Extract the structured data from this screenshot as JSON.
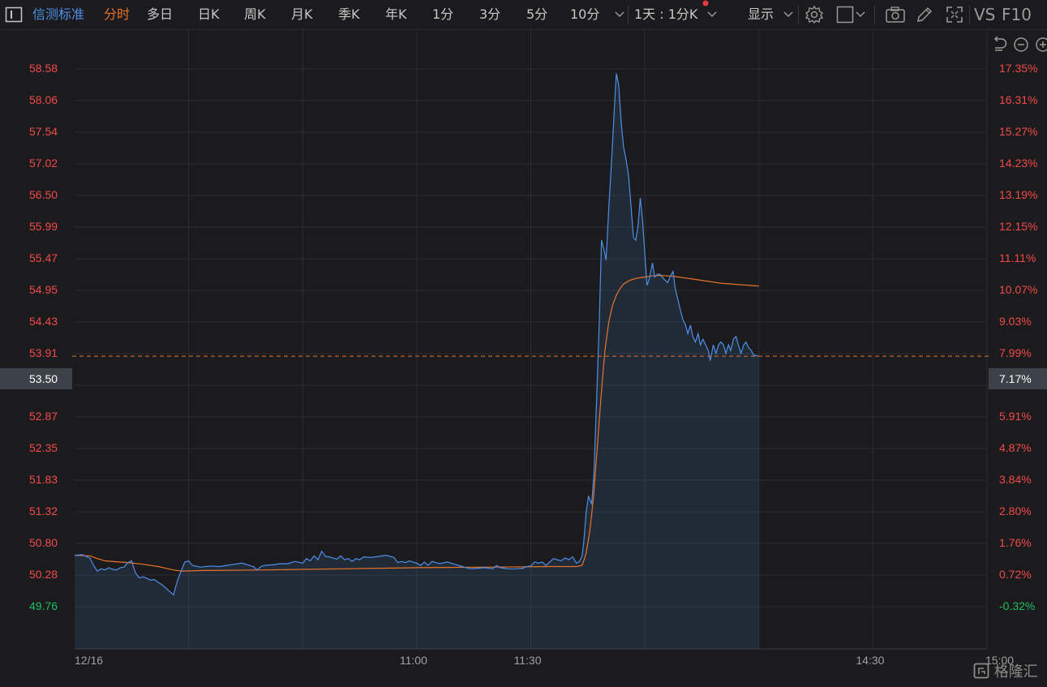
{
  "toolbar": {
    "stock_name": "信测标准",
    "active_tab": "分时",
    "tabs": [
      "多日",
      "日K",
      "周K",
      "月K",
      "季K",
      "年K",
      "1分",
      "3分",
      "5分",
      "10分"
    ],
    "period_select": "1天 : 1分K",
    "display_label": "显示",
    "vs_label": "VS",
    "f10_label": "F10"
  },
  "colors": {
    "price_line": "#4e8fe8",
    "avg_line": "#e8732a",
    "up": "#f24a4a",
    "down": "#1dbf60",
    "ref_line": "#e8732a"
  },
  "current": {
    "price": "53.50",
    "pct": "7.17%"
  },
  "watermark": "格隆汇",
  "chart_data": {
    "type": "line",
    "prev_close": 49.92,
    "ylim": [
      49.07,
      58.58
    ],
    "y_ticks_price": [
      "58.58",
      "58.06",
      "57.54",
      "57.02",
      "56.50",
      "55.99",
      "55.47",
      "54.95",
      "54.43",
      "53.91",
      "53.39",
      "52.87",
      "52.35",
      "51.83",
      "51.32",
      "50.80",
      "50.28",
      "49.76"
    ],
    "y_ticks_pct": [
      "17.35%",
      "16.31%",
      "15.27%",
      "14.23%",
      "13.19%",
      "12.15%",
      "11.11%",
      "10.07%",
      "9.03%",
      "7.99%",
      "6.95%",
      "5.91%",
      "4.87%",
      "3.84%",
      "2.80%",
      "1.76%",
      "0.72%",
      "-0.32%"
    ],
    "x_tick_labels": [
      {
        "minute": 0,
        "label": "12/16"
      },
      {
        "minute": 90,
        "label": "11:00"
      },
      {
        "minute": 120,
        "label": "11:30"
      },
      {
        "minute": 210,
        "label": "14:30"
      },
      {
        "minute": 240,
        "label": "15:00"
      }
    ],
    "session_minutes": 240,
    "x_grid_minutes": [
      30,
      60,
      90,
      120,
      150,
      180,
      210,
      240
    ],
    "series": [
      {
        "key": "price",
        "points": [
          [
            0,
            49.98
          ],
          [
            2,
            49.99
          ],
          [
            4,
            49.93
          ],
          [
            5,
            49.8
          ],
          [
            6,
            49.7
          ],
          [
            7,
            49.74
          ],
          [
            8,
            49.72
          ],
          [
            9,
            49.76
          ],
          [
            10,
            49.73
          ],
          [
            11,
            49.72
          ],
          [
            12,
            49.76
          ],
          [
            13,
            49.77
          ],
          [
            14,
            49.85
          ],
          [
            15,
            49.88
          ],
          [
            16,
            49.67
          ],
          [
            17,
            49.58
          ],
          [
            18,
            49.6
          ],
          [
            19,
            49.57
          ],
          [
            20,
            49.54
          ],
          [
            21,
            49.55
          ],
          [
            22,
            49.5
          ],
          [
            23,
            49.46
          ],
          [
            24,
            49.4
          ],
          [
            25,
            49.34
          ],
          [
            26,
            49.28
          ],
          [
            27,
            49.52
          ],
          [
            28,
            49.7
          ],
          [
            29,
            49.86
          ],
          [
            30,
            49.88
          ],
          [
            31,
            49.8
          ],
          [
            33,
            49.77
          ],
          [
            36,
            49.79
          ],
          [
            38,
            49.78
          ],
          [
            40,
            49.8
          ],
          [
            42,
            49.82
          ],
          [
            44,
            49.84
          ],
          [
            46,
            49.8
          ],
          [
            47,
            49.78
          ],
          [
            48,
            49.72
          ],
          [
            49,
            49.78
          ],
          [
            50,
            49.8
          ],
          [
            52,
            49.81
          ],
          [
            54,
            49.83
          ],
          [
            56,
            49.83
          ],
          [
            58,
            49.87
          ],
          [
            60,
            49.84
          ],
          [
            61,
            49.92
          ],
          [
            62,
            49.88
          ],
          [
            63,
            49.97
          ],
          [
            64,
            49.9
          ],
          [
            65,
            50.05
          ],
          [
            66,
            49.96
          ],
          [
            67,
            49.95
          ],
          [
            69,
            49.91
          ],
          [
            70,
            49.97
          ],
          [
            71,
            49.9
          ],
          [
            72,
            49.92
          ],
          [
            73,
            49.87
          ],
          [
            74,
            49.92
          ],
          [
            75,
            49.9
          ],
          [
            76,
            49.95
          ],
          [
            78,
            49.94
          ],
          [
            80,
            49.96
          ],
          [
            82,
            49.98
          ],
          [
            84,
            49.94
          ],
          [
            85,
            49.85
          ],
          [
            86,
            49.87
          ],
          [
            87,
            49.85
          ],
          [
            88,
            49.88
          ],
          [
            89,
            49.86
          ],
          [
            90,
            49.84
          ],
          [
            91,
            49.8
          ],
          [
            92,
            49.86
          ],
          [
            93,
            49.8
          ],
          [
            94,
            49.87
          ],
          [
            95,
            49.85
          ],
          [
            96,
            49.83
          ],
          [
            98,
            49.86
          ],
          [
            100,
            49.82
          ],
          [
            102,
            49.78
          ],
          [
            103,
            49.76
          ],
          [
            104,
            49.74
          ],
          [
            106,
            49.75
          ],
          [
            108,
            49.76
          ],
          [
            110,
            49.74
          ],
          [
            111,
            49.8
          ],
          [
            112,
            49.76
          ],
          [
            114,
            49.74
          ],
          [
            116,
            49.74
          ],
          [
            118,
            49.75
          ],
          [
            119,
            49.78
          ],
          [
            120,
            49.79
          ],
          [
            121,
            49.86
          ],
          [
            122,
            49.84
          ],
          [
            123,
            49.86
          ],
          [
            124,
            49.8
          ],
          [
            125,
            49.86
          ],
          [
            126,
            49.92
          ],
          [
            127,
            49.9
          ],
          [
            128,
            49.88
          ],
          [
            129,
            49.93
          ],
          [
            130,
            49.9
          ],
          [
            131,
            49.95
          ],
          [
            132,
            49.84
          ],
          [
            132.8,
            49.87
          ],
          [
            133.5,
            49.97
          ],
          [
            134,
            50.26
          ],
          [
            134.6,
            50.76
          ],
          [
            135.2,
            51.03
          ],
          [
            136,
            50.88
          ],
          [
            136.6,
            51.4
          ],
          [
            137.3,
            52.7
          ],
          [
            138,
            54.1
          ],
          [
            138.6,
            55.55
          ],
          [
            139.2,
            55.4
          ],
          [
            139.8,
            55.2
          ],
          [
            140.5,
            56.1
          ],
          [
            141.3,
            57.0
          ],
          [
            142,
            57.9
          ],
          [
            142.5,
            58.5
          ],
          [
            143.1,
            58.3
          ],
          [
            143.8,
            57.6
          ],
          [
            144.4,
            57.2
          ],
          [
            145,
            57.0
          ],
          [
            145.7,
            56.7
          ],
          [
            146.3,
            56.2
          ],
          [
            147,
            55.6
          ],
          [
            147.6,
            55.55
          ],
          [
            148.2,
            55.8
          ],
          [
            148.8,
            56.3
          ],
          [
            149.4,
            55.9
          ],
          [
            150,
            55.3
          ],
          [
            150.6,
            54.75
          ],
          [
            151.3,
            54.9
          ],
          [
            152,
            55.15
          ],
          [
            152.6,
            54.9
          ],
          [
            153.3,
            54.95
          ],
          [
            154,
            54.95
          ],
          [
            154.6,
            54.9
          ],
          [
            155.2,
            54.85
          ],
          [
            156,
            54.8
          ],
          [
            156.6,
            54.9
          ],
          [
            157.4,
            55.0
          ],
          [
            158,
            54.7
          ],
          [
            158.7,
            54.5
          ],
          [
            159.4,
            54.3
          ],
          [
            160,
            54.15
          ],
          [
            160.7,
            54.05
          ],
          [
            161.3,
            53.9
          ],
          [
            162,
            54.05
          ],
          [
            162.6,
            53.85
          ],
          [
            163.3,
            53.75
          ],
          [
            164,
            53.9
          ],
          [
            164.6,
            53.7
          ],
          [
            165.3,
            53.8
          ],
          [
            166,
            53.7
          ],
          [
            166.7,
            53.6
          ],
          [
            167.2,
            53.42
          ],
          [
            168,
            53.7
          ],
          [
            168.7,
            53.55
          ],
          [
            169.4,
            53.7
          ],
          [
            170,
            53.75
          ],
          [
            170.7,
            53.7
          ],
          [
            171.3,
            53.55
          ],
          [
            172,
            53.7
          ],
          [
            172.6,
            53.6
          ],
          [
            173.3,
            53.8
          ],
          [
            174,
            53.85
          ],
          [
            174.6,
            53.7
          ],
          [
            175.3,
            53.55
          ],
          [
            176,
            53.7
          ],
          [
            176.6,
            53.75
          ],
          [
            177.3,
            53.65
          ],
          [
            178,
            53.6
          ],
          [
            178.6,
            53.52
          ],
          [
            179.3,
            53.51
          ],
          [
            180,
            53.5
          ]
        ]
      },
      {
        "key": "avg",
        "points": [
          [
            0,
            49.98
          ],
          [
            4,
            49.97
          ],
          [
            6,
            49.92
          ],
          [
            8,
            49.88
          ],
          [
            14,
            49.85
          ],
          [
            18,
            49.82
          ],
          [
            22,
            49.78
          ],
          [
            26,
            49.72
          ],
          [
            28,
            49.7
          ],
          [
            34,
            49.71
          ],
          [
            50,
            49.72
          ],
          [
            70,
            49.74
          ],
          [
            90,
            49.76
          ],
          [
            110,
            49.77
          ],
          [
            125,
            49.78
          ],
          [
            132,
            49.78
          ],
          [
            133.5,
            49.8
          ],
          [
            134.5,
            50.0
          ],
          [
            135.5,
            50.4
          ],
          [
            136.5,
            51.0
          ],
          [
            137.5,
            51.9
          ],
          [
            138.5,
            52.8
          ],
          [
            139.5,
            53.6
          ],
          [
            140.5,
            54.1
          ],
          [
            141.5,
            54.4
          ],
          [
            142.5,
            54.58
          ],
          [
            143.5,
            54.7
          ],
          [
            144.5,
            54.78
          ],
          [
            146,
            54.84
          ],
          [
            148,
            54.88
          ],
          [
            150,
            54.9
          ],
          [
            152,
            54.92
          ],
          [
            154,
            54.93
          ],
          [
            156,
            54.92
          ],
          [
            158,
            54.91
          ],
          [
            160,
            54.89
          ],
          [
            162,
            54.87
          ],
          [
            164,
            54.85
          ],
          [
            166,
            54.83
          ],
          [
            168,
            54.81
          ],
          [
            170,
            54.79
          ],
          [
            172,
            54.78
          ],
          [
            174,
            54.77
          ],
          [
            176,
            54.76
          ],
          [
            178,
            54.75
          ],
          [
            180,
            54.74
          ]
        ]
      }
    ]
  }
}
